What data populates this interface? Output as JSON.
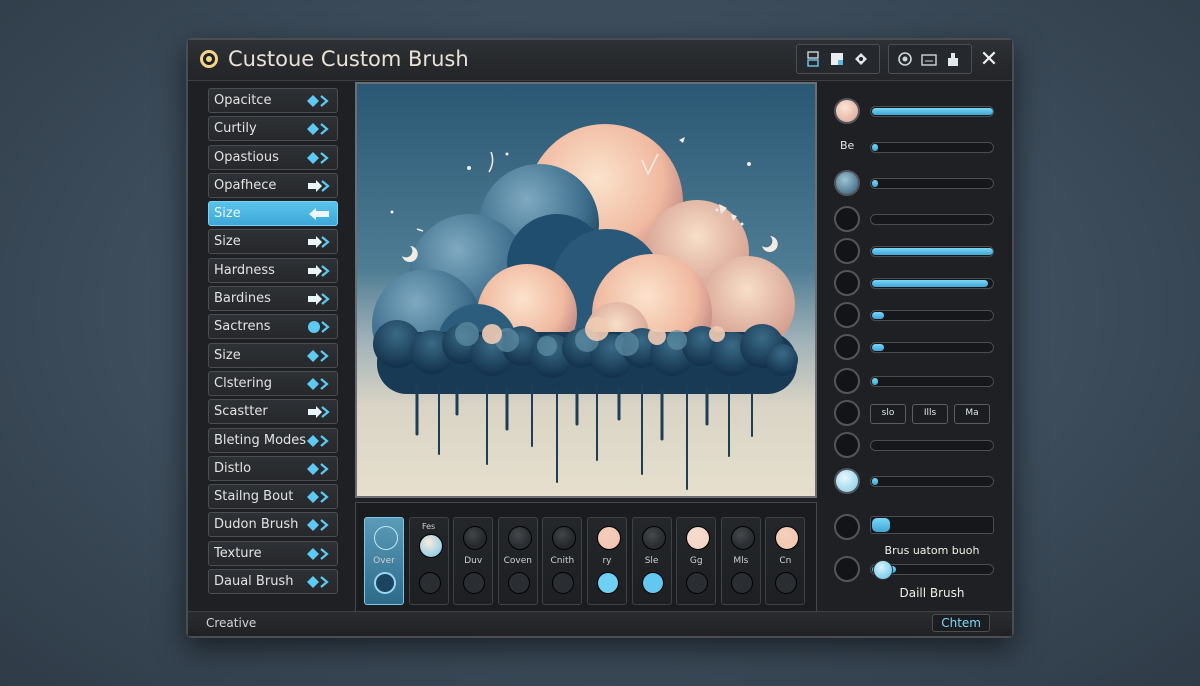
{
  "window": {
    "title": "Custoue Custom Brush",
    "close_glyph": "✕",
    "toolbar_left_icons": [
      "layer-icon",
      "square-icon",
      "diamond-icon"
    ],
    "toolbar_right_icons": [
      "circle-icon",
      "keyboard-icon",
      "stamp-icon"
    ]
  },
  "sidebar": {
    "items": [
      {
        "label": "Opacitce",
        "arrow": "diamond"
      },
      {
        "label": "Curtily",
        "arrow": "diamond"
      },
      {
        "label": "Opastious",
        "arrow": "diamond"
      },
      {
        "label": "Opafhece",
        "arrow": "solid"
      },
      {
        "label": "Size",
        "arrow": "back",
        "active": true
      },
      {
        "label": "Size",
        "arrow": "solid"
      },
      {
        "label": "Hardness",
        "arrow": "solid"
      },
      {
        "label": "Bardines",
        "arrow": "solid"
      },
      {
        "label": "Sactrens",
        "arrow": "circle"
      },
      {
        "label": "Size",
        "arrow": "diamond"
      },
      {
        "label": "Clstering",
        "arrow": "diamond"
      },
      {
        "label": "Scastter",
        "arrow": "solid"
      },
      {
        "label": "Bleting Modes",
        "arrow": "diamond"
      },
      {
        "label": "Distlo",
        "arrow": "diamond"
      },
      {
        "label": "Stailng Bout",
        "arrow": "diamond"
      },
      {
        "label": "Dudon Brush",
        "arrow": "diamond"
      },
      {
        "label": "Texture",
        "arrow": "diamond"
      },
      {
        "label": "Daual Brush",
        "arrow": "diamond"
      }
    ]
  },
  "presets": {
    "top_label": "Fes",
    "items": [
      {
        "label": "Over",
        "selected": true
      },
      {
        "label": ""
      },
      {
        "label": "Duv"
      },
      {
        "label": "Coven"
      },
      {
        "label": "Cnith"
      },
      {
        "label": "ry"
      },
      {
        "label": "Sle"
      },
      {
        "label": "Gg"
      },
      {
        "label": "Mls"
      },
      {
        "label": "Cn"
      }
    ]
  },
  "right_panel": {
    "be_label": "Be",
    "chip_labels": [
      "slo",
      "Ills",
      "Ma"
    ],
    "brush_label_1": "Brus uatom buoh",
    "brush_label_2": "Daill Brush",
    "slider_levels": [
      0.99,
      0.05,
      0.05,
      0,
      0.99,
      0.95,
      0.1,
      0.1,
      0.05,
      0.05,
      0,
      0.05,
      0.15,
      0.2
    ],
    "accent_color": "#4fb8e4"
  },
  "status": {
    "left_text": "Creative",
    "right_button": "Chtem"
  }
}
